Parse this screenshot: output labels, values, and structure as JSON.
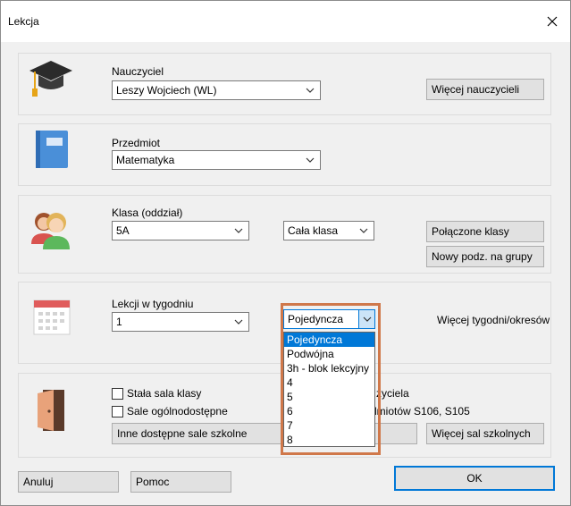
{
  "window": {
    "title": "Lekcja"
  },
  "teacher": {
    "label": "Nauczyciel",
    "value": "Leszy Wojciech (WL)",
    "more_button": "Więcej nauczycieli"
  },
  "subject": {
    "label": "Przedmiot",
    "value": "Matematyka"
  },
  "class": {
    "label": "Klasa (oddział)",
    "value": "5A",
    "group_value": "Cała klasa",
    "merged_button": "Połączone klasy",
    "split_button": "Nowy podz. na grupy"
  },
  "lessons": {
    "label": "Lekcji w tygodniu",
    "count_value": "1",
    "type_value": "Pojedyncza",
    "type_options": [
      "Pojedyncza",
      "Podwójna",
      "3h - blok lekcyjny",
      "4",
      "5",
      "6",
      "7",
      "8"
    ],
    "selected_index": 0,
    "more_weeks_label": "Więcej tygodni/okresów"
  },
  "rooms": {
    "fixed_room_label": "Stała sala klasy",
    "general_rooms_label": "Sale ogólnodostępne",
    "teacher_room_partial": "zyciela",
    "subject_rooms_partial": "dmiotów S106, S105",
    "other_rooms_button": "Inne dostępne sale szkolne",
    "more_rooms_button": "Więcej sal szkolnych"
  },
  "footer": {
    "cancel": "Anuluj",
    "help": "Pomoc",
    "ok": "OK"
  },
  "colors": {
    "accent": "#0078d7",
    "highlight_frame": "#d0784a"
  }
}
